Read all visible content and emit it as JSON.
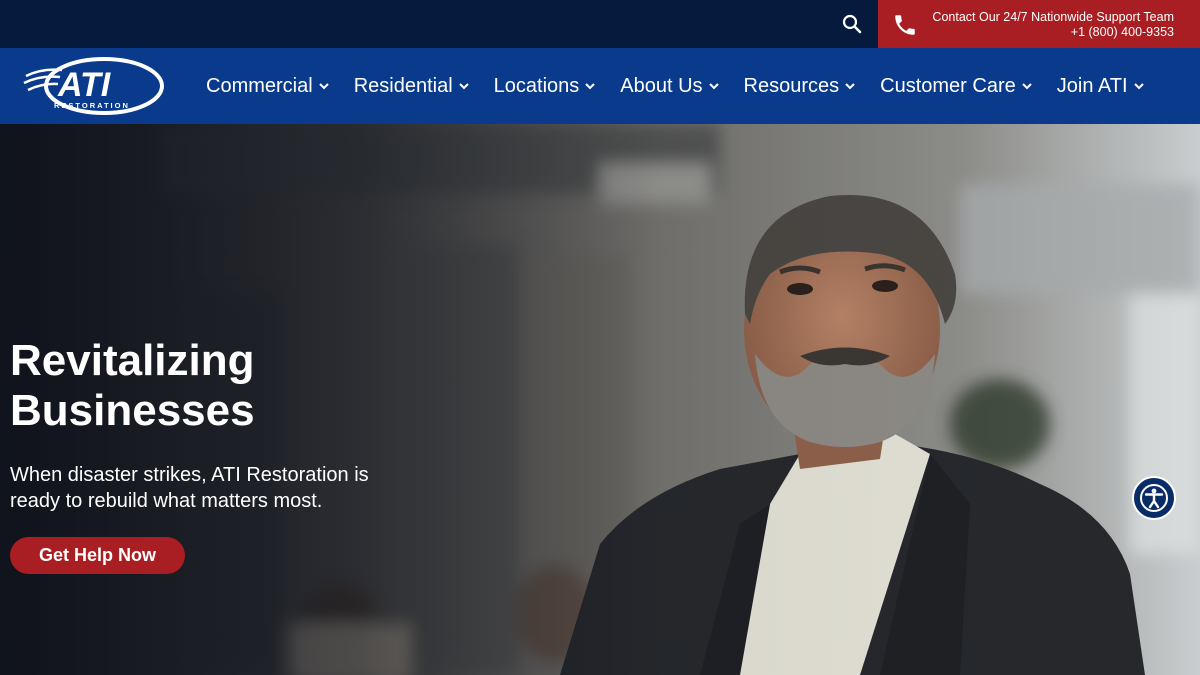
{
  "utility_bar": {
    "search_icon": "search-icon",
    "contact": {
      "line1": "Contact Our 24/7 Nationwide Support Team",
      "line2": "+1 (800) 400-9353",
      "icon": "phone-icon",
      "background": "#a91e22"
    }
  },
  "nav": {
    "logo_text": "ATI",
    "logo_subtext": "RESTORATION",
    "items": [
      {
        "label": "Commercial"
      },
      {
        "label": "Residential"
      },
      {
        "label": "Locations"
      },
      {
        "label": "About Us"
      },
      {
        "label": "Resources"
      },
      {
        "label": "Customer Care"
      },
      {
        "label": "Join ATI"
      }
    ],
    "background": "#0a3a8c"
  },
  "hero": {
    "title_line1": "Revitalizing",
    "title_line2": "Businesses",
    "subtitle": "When disaster strikes, ATI Restoration is ready to rebuild what matters most.",
    "cta_label": "Get Help Now",
    "cta_color": "#a91e22"
  },
  "accessibility": {
    "icon": "accessibility-icon"
  }
}
